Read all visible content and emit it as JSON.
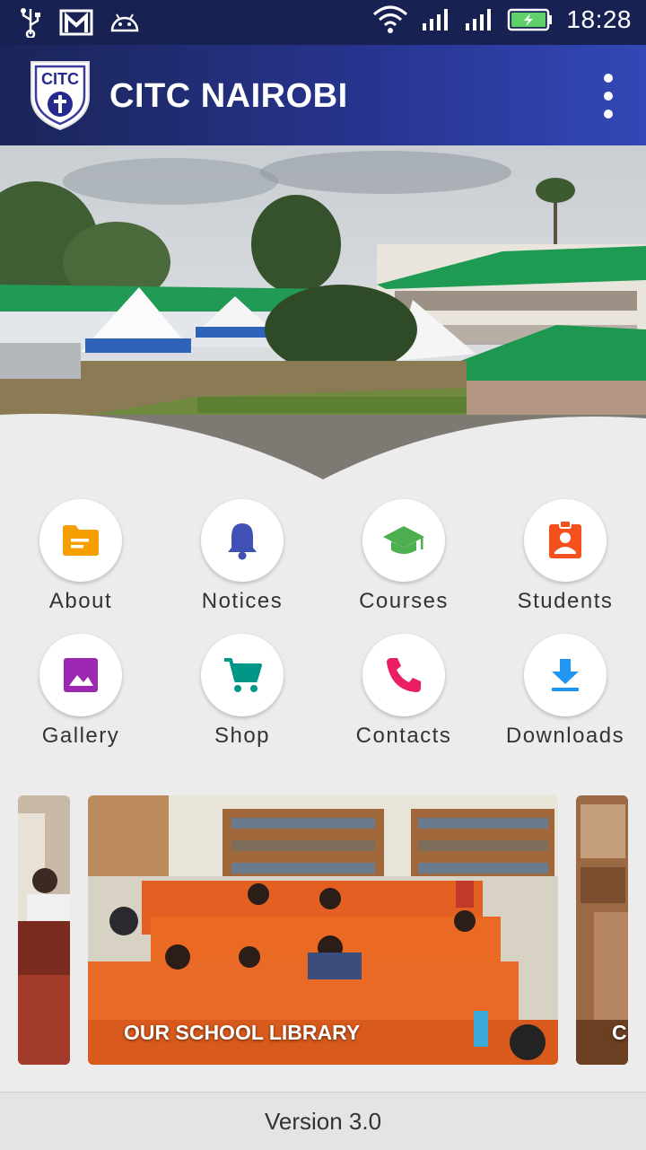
{
  "status_bar": {
    "time": "18:28",
    "left_icons": [
      "usb-icon",
      "gmail-icon",
      "android-icon"
    ],
    "right_icons": [
      "wifi-icon",
      "signal-icon",
      "signal-icon",
      "battery-charging-icon"
    ]
  },
  "app_bar": {
    "logo_text": "CITC",
    "title": "CITC NAIROBI",
    "menu_icon": "more-vert-icon"
  },
  "menu_items": [
    {
      "label": "About",
      "icon": "folder-icon",
      "color": "#f59f00"
    },
    {
      "label": "Notices",
      "icon": "bell-icon",
      "color": "#3f51b5"
    },
    {
      "label": "Courses",
      "icon": "graduation-cap-icon",
      "color": "#4caf50"
    },
    {
      "label": "Students",
      "icon": "id-badge-icon",
      "color": "#f4511e"
    },
    {
      "label": "Gallery",
      "icon": "image-icon",
      "color": "#9c27b0"
    },
    {
      "label": "Shop",
      "icon": "cart-icon",
      "color": "#009688"
    },
    {
      "label": "Contacts",
      "icon": "phone-icon",
      "color": "#e91e63"
    },
    {
      "label": "Downloads",
      "icon": "download-icon",
      "color": "#2196f3"
    }
  ],
  "carousel": {
    "slides": [
      {
        "caption": ""
      },
      {
        "caption": "OUR SCHOOL LIBRARY"
      },
      {
        "caption": "C..."
      }
    ]
  },
  "footer": {
    "version": "Version 3.0"
  }
}
